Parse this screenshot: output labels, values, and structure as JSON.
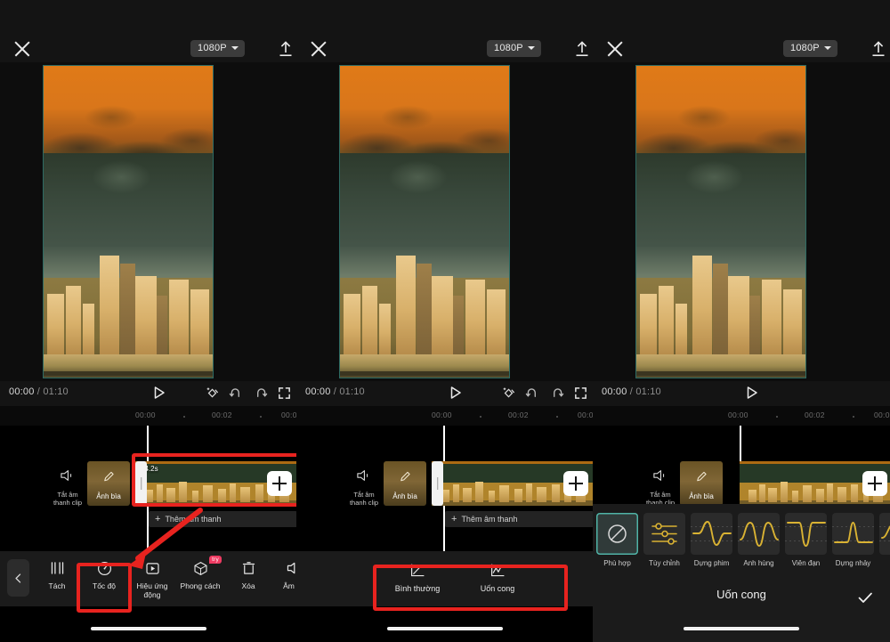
{
  "app": {
    "resolution_label": "1080P",
    "current_time": "00:00",
    "total_time": "01:10",
    "time_separator": "/"
  },
  "ruler": {
    "ticks": [
      "00:00",
      "00:02",
      "00:0"
    ]
  },
  "timeline": {
    "mute_label_line1": "Tắt âm",
    "mute_label_line2": "thanh clip",
    "cover_label": "Ảnh bìa",
    "clip_duration": "34.2s",
    "add_audio_label": "Thêm âm thanh",
    "add_audio_plus": "+"
  },
  "toolbar": {
    "items": [
      {
        "label": "Tách",
        "icon": "split-icon"
      },
      {
        "label": "Tốc độ",
        "icon": "speed-icon"
      },
      {
        "label": "Hiệu ứng động",
        "icon": "animation-icon"
      },
      {
        "label": "Phong cách",
        "icon": "style-icon",
        "badge": "try"
      },
      {
        "label": "Xóa",
        "icon": "delete-icon"
      },
      {
        "label": "Âm lu",
        "icon": "volume-icon"
      }
    ]
  },
  "speed_modes": {
    "items": [
      {
        "label": "Bình thường",
        "icon": "linear-speed-icon"
      },
      {
        "label": "Uốn cong",
        "icon": "curve-speed-icon"
      }
    ]
  },
  "curve_panel": {
    "title": "Uốn cong",
    "presets": [
      {
        "label": "Phù hợp",
        "icon": "none-icon",
        "selected": true
      },
      {
        "label": "Tùy chỉnh",
        "icon": "sliders-icon",
        "selected": false
      },
      {
        "label": "Dựng phim",
        "icon": "montage-curve-icon",
        "selected": false
      },
      {
        "label": "Anh hùng",
        "icon": "hero-curve-icon",
        "selected": false
      },
      {
        "label": "Viên đạn",
        "icon": "bullet-curve-icon",
        "selected": false
      },
      {
        "label": "Dựng nhảy",
        "icon": "jump-cut-curve-icon",
        "selected": false
      },
      {
        "label": "",
        "icon": "partial-curve-icon",
        "selected": false
      }
    ]
  },
  "colors": {
    "accent_teal": "#4fb3a6",
    "curve_yellow": "#d9b233",
    "annotation_red": "#e8231f",
    "badge_pink": "#ee3b62",
    "panel_bg": "#1b1b1b"
  }
}
